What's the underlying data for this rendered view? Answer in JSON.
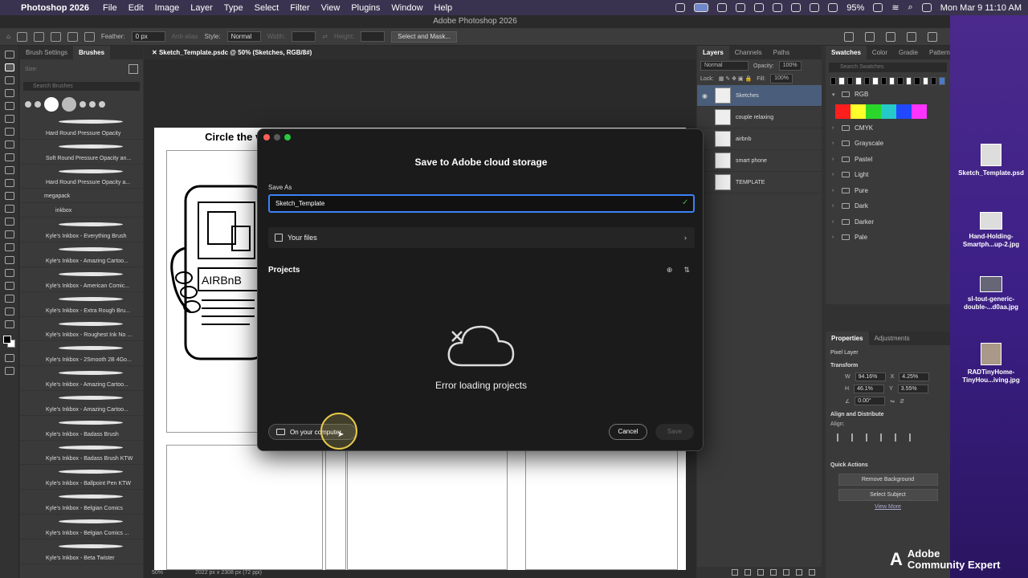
{
  "menubar": {
    "app_name": "Photoshop 2026",
    "items": [
      "File",
      "Edit",
      "Image",
      "Layer",
      "Type",
      "Select",
      "Filter",
      "View",
      "Plugins",
      "Window",
      "Help"
    ],
    "battery": "95%",
    "clock": "Mon Mar 9  11:10 AM"
  },
  "window": {
    "title": "Adobe Photoshop 2026"
  },
  "options_bar": {
    "feather_label": "Feather:",
    "feather_value": "0 px",
    "anti_alias": "Anti-alias",
    "style_label": "Style:",
    "style_value": "Normal",
    "width_label": "Width:",
    "height_label": "Height:",
    "select_mask": "Select and Mask..."
  },
  "brushes_panel": {
    "tabs": [
      "Brush Settings",
      "Brushes"
    ],
    "size_label": "Size:",
    "search_placeholder": "Search Brushes",
    "tip_sizes": [
      "7",
      "7",
      "9",
      "9",
      "9",
      "15"
    ],
    "items": [
      {
        "label": "Hard Round Pressure Opacity",
        "kind": "brush"
      },
      {
        "label": "Soft Round Pressure Opacity an...",
        "kind": "brush"
      },
      {
        "label": "Hard Round Pressure Opacity a...",
        "kind": "brush"
      },
      {
        "label": "megapack",
        "kind": "group"
      },
      {
        "label": "inkbox",
        "kind": "subgroup"
      },
      {
        "label": "Kyle's Inkbox - Everything Brush",
        "kind": "brush"
      },
      {
        "label": "Kyle's Inkbox - Amazing Cartoo...",
        "kind": "brush"
      },
      {
        "label": "Kyle's Inkbox - American Comic...",
        "kind": "brush"
      },
      {
        "label": "Kyle's Inkbox - Extra Rough Bru...",
        "kind": "brush"
      },
      {
        "label": "Kyle's Inkbox - Roughest Ink No ...",
        "kind": "brush"
      },
      {
        "label": "Kyle's Inkbox - 2Smooth 2B 4Go...",
        "kind": "brush"
      },
      {
        "label": "Kyle's Inkbox - Amazing Cartoo...",
        "kind": "brush"
      },
      {
        "label": "Kyle's Inkbox - Amazing Cartoo...",
        "kind": "brush"
      },
      {
        "label": "Kyle's Inkbox - Badass Brush",
        "kind": "brush"
      },
      {
        "label": "Kyle's Inkbox - Badass Brush KTW",
        "kind": "brush"
      },
      {
        "label": "Kyle's Inkbox - Ballpoint Pen KTW",
        "kind": "brush"
      },
      {
        "label": "Kyle's Inkbox - Belgian Comics",
        "kind": "brush"
      },
      {
        "label": "Kyle's Inkbox - Belgian Comics ...",
        "kind": "brush"
      },
      {
        "label": "Kyle's Inkbox - Beta Twister",
        "kind": "brush"
      }
    ]
  },
  "document": {
    "tab_title": "Sketch_Template.psdc @ 50% (Sketches, RGB/8#)",
    "headline": "Circle the video ad you are using as a guide for your story: Expedia, JIF, Koe, or Bubly.",
    "sketch_text": "AIRBnB",
    "zoom": "50%",
    "dimensions": "2022 px x 2308 px (72 ppi)"
  },
  "layers_panel": {
    "tabs": [
      "Layers",
      "Channels",
      "Paths"
    ],
    "blend_mode": "Normal",
    "opacity_label": "Opacity:",
    "opacity_value": "100%",
    "lock_label": "Lock:",
    "fill_label": "Fill:",
    "fill_value": "100%",
    "layers": [
      {
        "name": "Sketches",
        "active": true
      },
      {
        "name": "couple relaxing",
        "active": false
      },
      {
        "name": "airbnb",
        "active": false
      },
      {
        "name": "smart phone",
        "active": false
      },
      {
        "name": "TEMPLATE",
        "active": false
      }
    ]
  },
  "swatches_panel": {
    "tabs": [
      "Swatches",
      "Color",
      "Gradie",
      "Pattern"
    ],
    "search_placeholder": "Search Swatches",
    "recent_colors": [
      "#000000",
      "#ffffff",
      "#000000",
      "#ffffff",
      "#000000",
      "#ffffff",
      "#000000",
      "#ffffff",
      "#000000",
      "#ffffff",
      "#000000",
      "#ffffff",
      "#000000",
      "#4a7ac8"
    ],
    "rgb_colors": [
      "#ff1e1e",
      "#ffff2a",
      "#2bd62b",
      "#26c9c9",
      "#2248ff",
      "#ff33ff"
    ],
    "groups": [
      "RGB",
      "CMYK",
      "Grayscale",
      "Pastel",
      "Light",
      "Pure",
      "Dark",
      "Darker",
      "Pale"
    ]
  },
  "properties_panel": {
    "tabs": [
      "Properties",
      "Adjustments"
    ],
    "layer_type": "Pixel Layer",
    "transform_label": "Transform",
    "w_label": "W",
    "w_value": "94.16%",
    "x_label": "X",
    "x_value": "4.25%",
    "h_label": "H",
    "h_value": "46.1%",
    "y_label": "Y",
    "y_value": "3.55%",
    "angle_value": "0.00°",
    "align_label": "Align and Distribute",
    "align_sub": "Align:",
    "quick_actions_label": "Quick Actions",
    "remove_bg": "Remove Background",
    "select_subject": "Select Subject",
    "view_more": "View More"
  },
  "dialog": {
    "title": "Save to Adobe cloud storage",
    "save_as_label": "Save As",
    "filename": "Sketch_Template",
    "your_files": "Your files",
    "projects_label": "Projects",
    "error_text": "Error loading projects",
    "on_computer": "On your computer",
    "cancel": "Cancel",
    "save": "Save"
  },
  "desktop": {
    "files": [
      {
        "name": "Sketch_Template.psd"
      },
      {
        "name": "Hand-Holding-Smartph...up-2.jpg"
      },
      {
        "name": "sl-tout-generic-double-...d0aa.jpg"
      },
      {
        "name": "RADTinyHome-TinyHou...iving.jpg"
      }
    ],
    "watermark_line1": "Adobe",
    "watermark_line2": "Community Expert"
  },
  "colors": {
    "accent": "#3b82f6",
    "active_layer": "#4a5d7a",
    "traffic_red": "#ff5f57",
    "traffic_yellow": "#febc2e",
    "traffic_green": "#28c840"
  }
}
